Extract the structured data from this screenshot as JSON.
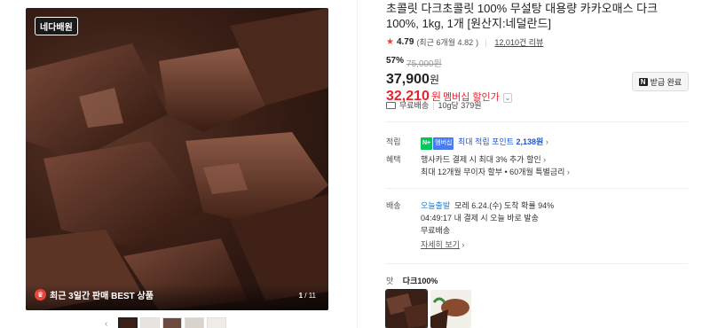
{
  "gallery": {
    "badge": "네다배원",
    "best_label": "최근 3일간 판매 BEST 상품",
    "page_current": "1",
    "page_total": "/ 11",
    "thumb_prev": "‹"
  },
  "product": {
    "title": "초콜릿 다크초콜릿 100% 무설탕 대용량 카카오매스 다크100%, 1kg, 1개 [원산지:네덜란드]",
    "rating": "4.79",
    "rating_recent": "(최근 6개월 4.82",
    "review_count": "12,010건 리뷰",
    "discount": "57%",
    "original_price": "75,000원",
    "price": "37,900",
    "price_unit": "원",
    "member_price": "32,210",
    "member_unit": "원",
    "member_label": "멤버십 할인가",
    "coupon_label": "받급 완료",
    "shipping": "무료배송",
    "unit_price": "10g당 379원"
  },
  "points": {
    "label": "적립",
    "badge_n": "N+",
    "badge_member": "멤버십",
    "text": "최대 적립 포인트",
    "amount": "2,138원"
  },
  "benefits": {
    "label": "혜택",
    "line1": "행사카드 결제 시 최대 3% 추가 할인",
    "line2": "최대 12개월 무이자 할부 • 60개월 특별금리"
  },
  "delivery": {
    "label": "배송",
    "today": "오늘출발",
    "arrival": "모레 6.24.(수) 도착 확률 94%",
    "countdown": "04:49:17",
    "countdown_text": "내 결제 시 오늘 바로 발송",
    "free": "무료배송",
    "detail_link": "자세히 보기"
  },
  "option": {
    "label": "맛",
    "selected": "다크100%"
  },
  "colors": {
    "member_red": "#e8232d",
    "npay_green": "#03c75a",
    "link_blue": "#1a56db"
  }
}
